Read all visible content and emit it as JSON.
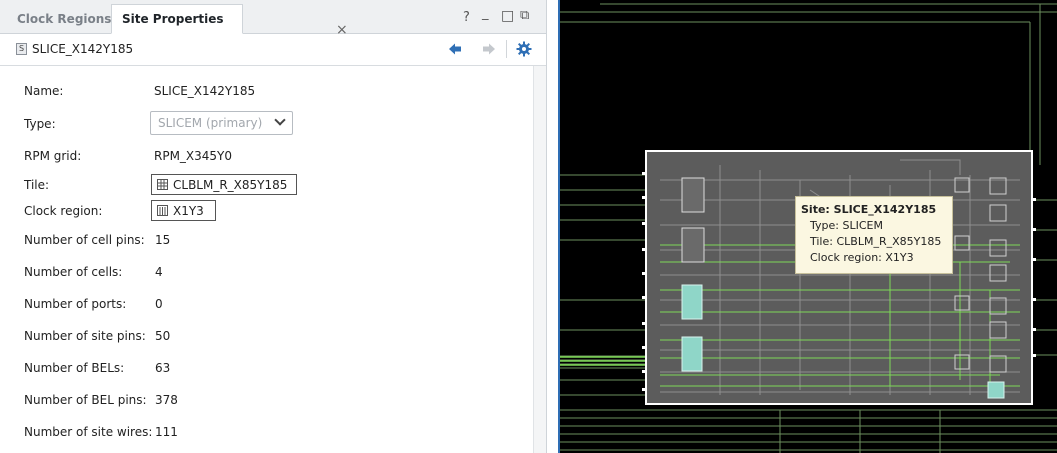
{
  "tabs": {
    "clock_regions": "Clock Regions",
    "site_properties": "Site Properties",
    "close_symbol": "×"
  },
  "window_controls": {
    "help": "?",
    "minimize": "_",
    "maximize": "□",
    "float": "⧉"
  },
  "toolbar": {
    "badge": "S",
    "title": "SLICE_X142Y185"
  },
  "properties": {
    "name": {
      "label": "Name:",
      "value": "SLICE_X142Y185"
    },
    "type": {
      "label": "Type:",
      "value": "SLICEM (primary)"
    },
    "rpm_grid": {
      "label": "RPM grid:",
      "value": "RPM_X345Y0"
    },
    "tile": {
      "label": "Tile:",
      "value": "CLBLM_R_X85Y185"
    },
    "clock_region": {
      "label": "Clock region:",
      "value": "X1Y3"
    },
    "cell_pins": {
      "label": "Number of cell pins:",
      "value": "15"
    },
    "cells": {
      "label": "Number of cells:",
      "value": "4"
    },
    "ports": {
      "label": "Number of ports:",
      "value": "0"
    },
    "site_pins": {
      "label": "Number of site pins:",
      "value": "50"
    },
    "bels": {
      "label": "Number of BELs:",
      "value": "63"
    },
    "bel_pins": {
      "label": "Number of BEL pins:",
      "value": "378"
    },
    "site_wires": {
      "label": "Number of site wires:",
      "value": "111"
    }
  },
  "tooltip": {
    "title": "Site: SLICE_X142Y185",
    "type": "Type: SLICEM",
    "tile": "Tile: CLBLM_R_X85Y185",
    "clock_region": "Clock region: X1Y3"
  },
  "colors": {
    "accent_blue": "#2f6fb5",
    "device_background": "#000000",
    "slice_fill": "#5a5a5a",
    "route_green": "#7ed957",
    "highlight_cyan": "#8fd6c8",
    "tooltip_bg": "#fbf7e1"
  }
}
